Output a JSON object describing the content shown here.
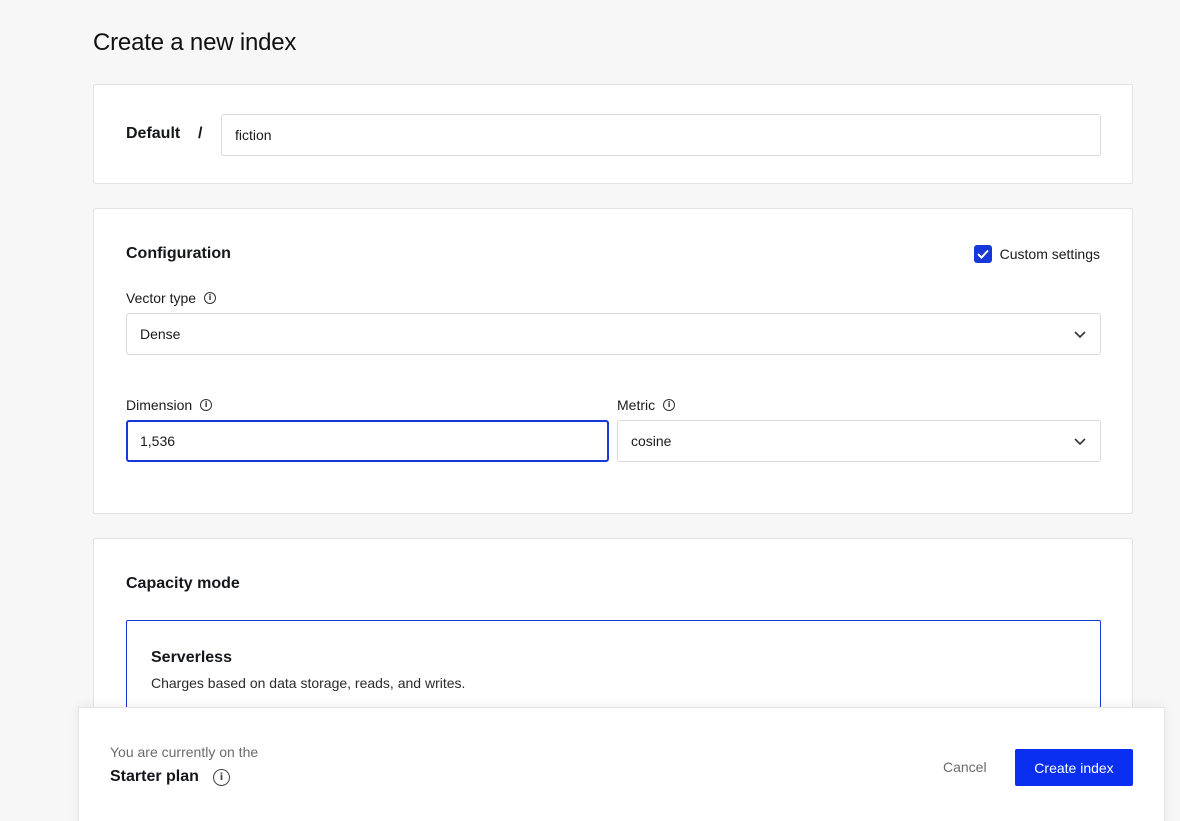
{
  "page": {
    "title": "Create a new index"
  },
  "name_card": {
    "project": "Default",
    "separator": "/",
    "index_name": "fiction"
  },
  "configuration": {
    "title": "Configuration",
    "custom_settings": {
      "label": "Custom settings",
      "checked": true
    },
    "vector_type": {
      "label": "Vector type",
      "value": "Dense"
    },
    "dimension": {
      "label": "Dimension",
      "value": "1,536"
    },
    "metric": {
      "label": "Metric",
      "value": "cosine"
    }
  },
  "capacity": {
    "title": "Capacity mode",
    "option": {
      "title": "Serverless",
      "description": "Charges based on data storage, reads, and writes."
    }
  },
  "footer": {
    "plan_prefix": "You are currently on the",
    "plan_name": "Starter plan",
    "cancel_label": "Cancel",
    "create_label": "Create index"
  },
  "icons": {
    "info": "info-icon",
    "chevron": "chevron-down-icon",
    "check": "check-icon"
  },
  "colors": {
    "accent": "#0a2ff0",
    "focus_border": "#1638d9"
  }
}
